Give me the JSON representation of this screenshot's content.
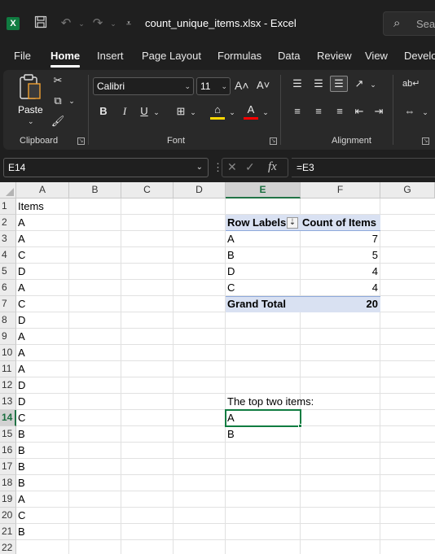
{
  "titlebar": {
    "app_icon": "X",
    "title": "count_unique_items.xlsx  -  Excel",
    "search_placeholder": "Sear",
    "icons": [
      "save-icon",
      "undo-icon",
      "redo-icon",
      "customize-qat-icon",
      "search-icon"
    ]
  },
  "tabs": [
    "File",
    "Home",
    "Insert",
    "Page Layout",
    "Formulas",
    "Data",
    "Review",
    "View",
    "Develo"
  ],
  "active_tab": "Home",
  "ribbon": {
    "clipboard": {
      "paste_label": "Paste",
      "group_label": "Clipboard"
    },
    "font": {
      "font_name": "Calibri",
      "font_size": "11",
      "group_label": "Font",
      "bold": "B",
      "italic": "I",
      "underline": "U",
      "grow": "A˄",
      "shrink": "A˅",
      "font_color_letter": "A",
      "highlight_color": "#ffd800",
      "font_color": "#ff0000"
    },
    "alignment": {
      "group_label": "Alignment"
    }
  },
  "formula_bar": {
    "name_box": "E14",
    "fx_label": "fx",
    "formula": "=E3"
  },
  "grid": {
    "columns": [
      "A",
      "B",
      "C",
      "D",
      "E",
      "F",
      "G"
    ],
    "selected_column": "E",
    "rows": [
      "1",
      "2",
      "3",
      "4",
      "5",
      "6",
      "7",
      "8",
      "9",
      "10",
      "11",
      "12",
      "13",
      "14",
      "15",
      "16",
      "17",
      "18",
      "19",
      "20",
      "21",
      "22"
    ],
    "selected_row": "14",
    "column_a": [
      "Items",
      "A",
      "A",
      "C",
      "D",
      "A",
      "C",
      "D",
      "A",
      "A",
      "A",
      "D",
      "D",
      "C",
      "B",
      "B",
      "B",
      "B",
      "A",
      "C",
      "B",
      ""
    ],
    "pivot": {
      "header_labels": "Row Labels",
      "header_values": "Count of Items",
      "rows": [
        {
          "label": "A",
          "value": "7"
        },
        {
          "label": "B",
          "value": "5"
        },
        {
          "label": "D",
          "value": "4"
        },
        {
          "label": "C",
          "value": "4"
        }
      ],
      "total_label": "Grand Total",
      "total_value": "20"
    },
    "note_text": "The top two items:",
    "top_items": [
      "A",
      "B"
    ]
  }
}
